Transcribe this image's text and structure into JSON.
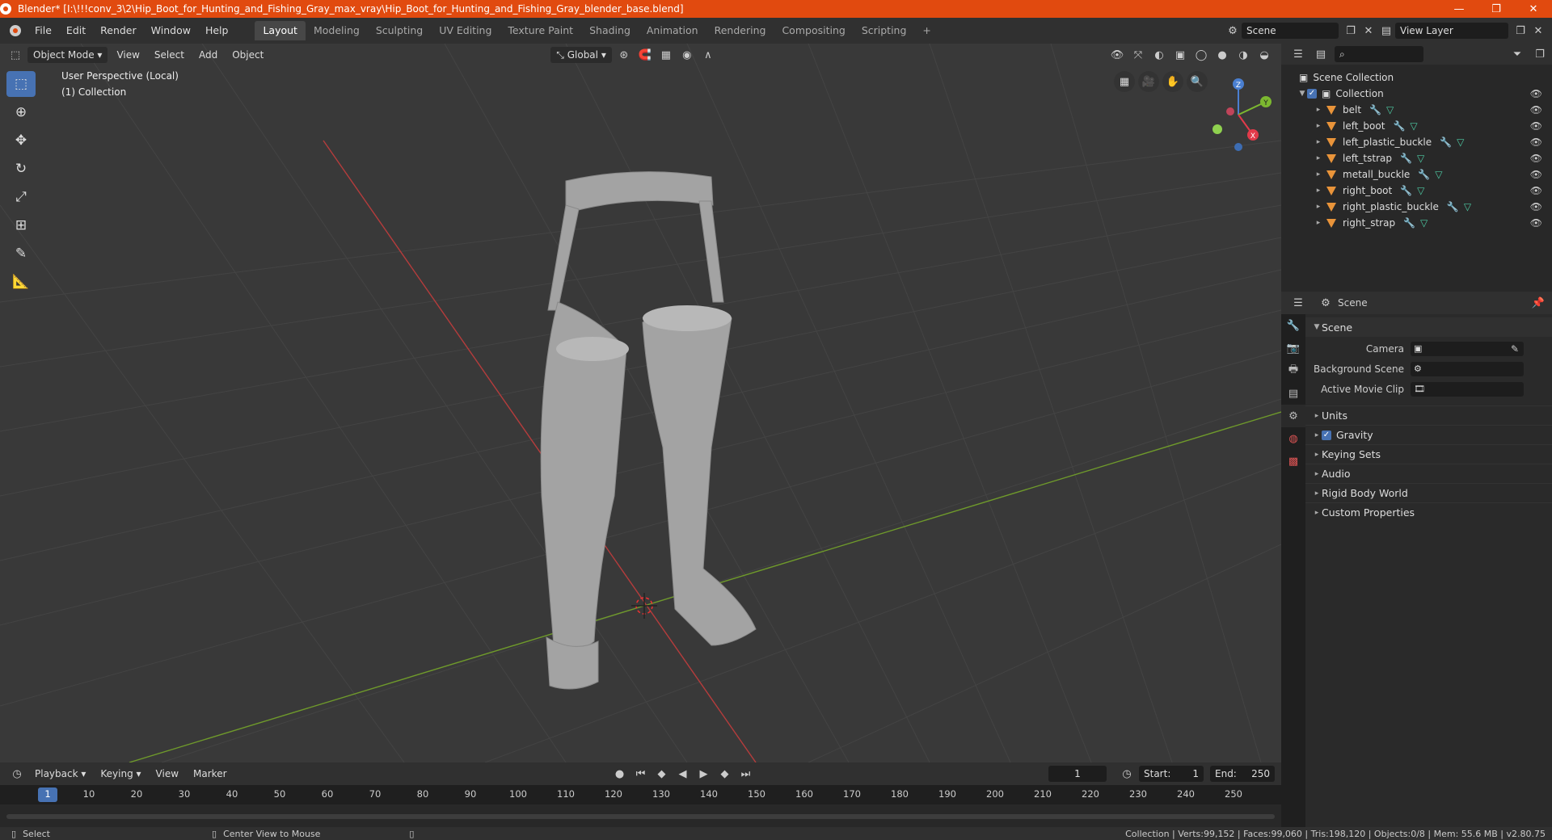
{
  "window": {
    "title": "Blender* [I:\\!!!conv_3\\2\\Hip_Boot_for_Hunting_and_Fishing_Gray_max_vray\\Hip_Boot_for_Hunting_and_Fishing_Gray_blender_base.blend]",
    "min": "—",
    "max": "❐",
    "close": "✕"
  },
  "menu": [
    "File",
    "Edit",
    "Render",
    "Window",
    "Help"
  ],
  "workspaces": [
    {
      "label": "Layout",
      "active": true
    },
    {
      "label": "Modeling"
    },
    {
      "label": "Sculpting"
    },
    {
      "label": "UV Editing"
    },
    {
      "label": "Texture Paint"
    },
    {
      "label": "Shading"
    },
    {
      "label": "Animation"
    },
    {
      "label": "Rendering"
    },
    {
      "label": "Compositing"
    },
    {
      "label": "Scripting"
    }
  ],
  "scene_field": "Scene",
  "view_layer_field": "View Layer",
  "add_ws": "+",
  "viewport": {
    "mode": "Object Mode",
    "menu": [
      "View",
      "Select",
      "Add",
      "Object"
    ],
    "transform": "Global",
    "info_line1": "User Perspective (Local)",
    "info_line2": "(1) Collection"
  },
  "gizmo": {
    "x": "X",
    "y": "Y",
    "z": "Z"
  },
  "outliner": {
    "root": "Scene Collection",
    "collection": "Collection",
    "items": [
      "belt",
      "left_boot",
      "left_plastic_buckle",
      "left_tstrap",
      "metall_buckle",
      "right_boot",
      "right_plastic_buckle",
      "right_strap"
    ]
  },
  "properties": {
    "header": "Scene",
    "panel": "Scene",
    "camera_label": "Camera",
    "background_label": "Background Scene",
    "movieclip_label": "Active Movie Clip",
    "subpanels": [
      "Units",
      "Gravity",
      "Keying Sets",
      "Audio",
      "Rigid Body World",
      "Custom Properties"
    ]
  },
  "timeline": {
    "menu": [
      "Playback",
      "Keying",
      "View",
      "Marker"
    ],
    "current_frame": "1",
    "start_label": "Start:",
    "start": "1",
    "end_label": "End:",
    "end": "250",
    "ticks": [
      "1",
      "10",
      "20",
      "30",
      "40",
      "50",
      "60",
      "70",
      "80",
      "90",
      "100",
      "110",
      "120",
      "130",
      "140",
      "150",
      "160",
      "170",
      "180",
      "190",
      "200",
      "210",
      "220",
      "230",
      "240",
      "250"
    ]
  },
  "status": {
    "select": "Select",
    "center": "Center View to Mouse",
    "stats": "Collection | Verts:99,152 | Faces:99,060 | Tris:198,120 | Objects:0/8 | Mem: 55.6 MB | v2.80.75"
  }
}
